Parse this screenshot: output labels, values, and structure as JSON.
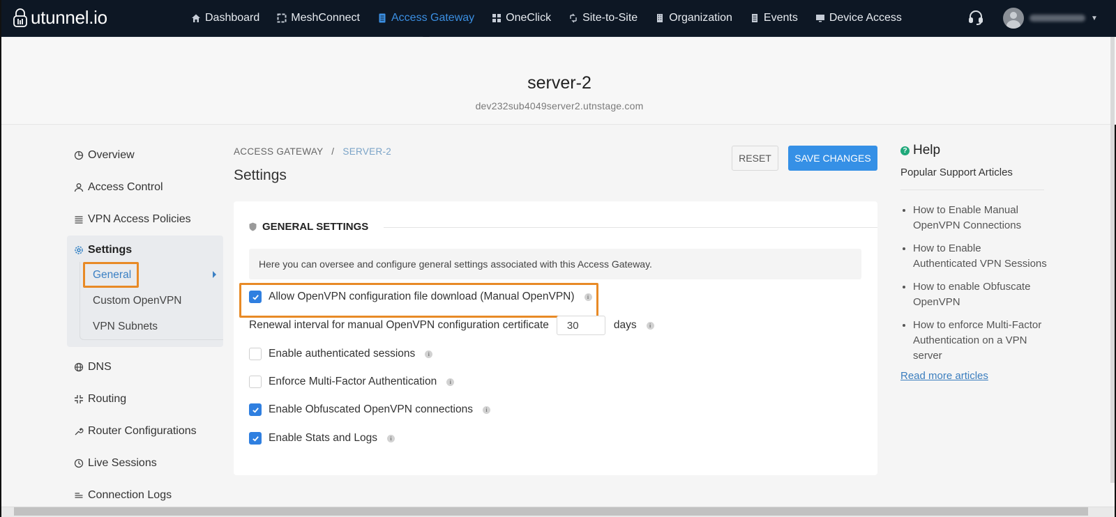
{
  "app": {
    "logo_text": "utunnel.io"
  },
  "nav": {
    "items": [
      {
        "label": "Dashboard",
        "icon": "home-icon",
        "active": false
      },
      {
        "label": "MeshConnect",
        "icon": "mesh-icon",
        "active": false
      },
      {
        "label": "Access Gateway",
        "icon": "gateway-icon",
        "active": true
      },
      {
        "label": "OneClick",
        "icon": "grid-icon",
        "active": false
      },
      {
        "label": "Site-to-Site",
        "icon": "arrows-icon",
        "active": false
      },
      {
        "label": "Organization",
        "icon": "building-icon",
        "active": false
      },
      {
        "label": "Events",
        "icon": "list-icon",
        "active": false
      },
      {
        "label": "Device Access",
        "icon": "monitor-icon",
        "active": false
      }
    ],
    "support_icon": "headset-icon",
    "user_menu_icon": "chevron-down-icon"
  },
  "server": {
    "name": "server-2",
    "hostname": "dev232sub4049server2.utnstage.com"
  },
  "sidebar": {
    "items": [
      {
        "label": "Overview",
        "icon": "pie-chart-icon"
      },
      {
        "label": "Access Control",
        "icon": "user-icon"
      },
      {
        "label": "VPN Access Policies",
        "icon": "policies-icon"
      }
    ],
    "settings": {
      "label": "Settings",
      "icon": "gear-icon",
      "subitems": [
        {
          "label": "General",
          "active": true
        },
        {
          "label": "Custom OpenVPN",
          "active": false
        },
        {
          "label": "VPN Subnets",
          "active": false
        }
      ]
    },
    "items_after": [
      {
        "label": "DNS",
        "icon": "globe-icon"
      },
      {
        "label": "Routing",
        "icon": "routing-icon"
      },
      {
        "label": "Router Configurations",
        "icon": "wrench-icon"
      },
      {
        "label": "Live Sessions",
        "icon": "clock-icon"
      },
      {
        "label": "Connection Logs",
        "icon": "logs-icon"
      }
    ]
  },
  "breadcrumb": {
    "parent": "ACCESS GATEWAY",
    "separator": "/",
    "current": "SERVER-2"
  },
  "page": {
    "title": "Settings"
  },
  "toolbar": {
    "reset_label": "RESET",
    "save_label": "SAVE CHANGES"
  },
  "general": {
    "section_title": "GENERAL SETTINGS",
    "description": "Here you can oversee and configure general settings associated with this Access Gateway.",
    "allow_download": {
      "label": "Allow OpenVPN configuration file download (Manual OpenVPN)",
      "checked": true
    },
    "renewal": {
      "label": "Renewal interval for manual OpenVPN configuration certificate",
      "value": "30",
      "unit": "days"
    },
    "options": [
      {
        "label": "Enable authenticated sessions",
        "checked": false
      },
      {
        "label": "Enforce Multi-Factor Authentication",
        "checked": false
      },
      {
        "label": "Enable Obfuscated OpenVPN connections",
        "checked": true
      },
      {
        "label": "Enable Stats and Logs",
        "checked": true
      }
    ]
  },
  "help": {
    "title": "Help",
    "subtitle": "Popular Support Articles",
    "articles": [
      "How to Enable Manual OpenVPN Connections",
      "How to Enable Authenticated VPN Sessions",
      "How to enable Obfuscate OpenVPN",
      "How to enforce Multi-Factor Authentication on a VPN server"
    ],
    "read_more": "Read more articles"
  },
  "colors": {
    "accent": "#3590e6",
    "highlight": "#e88a26",
    "topbar": "#0d1724",
    "help_icon": "#1fa87a"
  }
}
